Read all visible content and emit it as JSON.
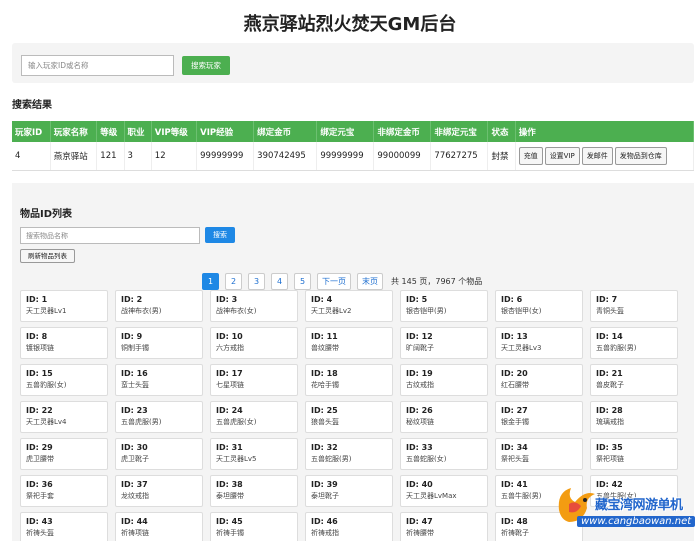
{
  "title": "燕京驿站烈火焚天GM后台",
  "player_search": {
    "placeholder": "输入玩家ID或名称",
    "button": "搜索玩家"
  },
  "results": {
    "heading": "搜索结果",
    "columns": [
      "玩家ID",
      "玩家名称",
      "等级",
      "职业",
      "VIP等级",
      "VIP经验",
      "绑定金币",
      "绑定元宝",
      "非绑定金币",
      "非绑定元宝",
      "状态",
      "操作"
    ],
    "rows": [
      {
        "cells": [
          "4",
          "燕京驿站",
          "121",
          "3",
          "12",
          "99999999",
          "390742495",
          "99999999",
          "99000099",
          "77627275",
          "封禁"
        ],
        "actions": [
          "充值",
          "设置VIP",
          "发邮件",
          "发物品到仓库"
        ]
      }
    ]
  },
  "items": {
    "heading": "物品ID列表",
    "search_placeholder": "搜索物品名称",
    "search_button": "搜索",
    "refresh_button": "刷新物品列表",
    "pages": [
      "1",
      "2",
      "3",
      "4",
      "5"
    ],
    "active_page": "1",
    "next": "下一页",
    "last": "末页",
    "summary": "共 145 页，7967 个物品",
    "list": [
      {
        "id": "ID: 1",
        "name": "天工灵器Lv1"
      },
      {
        "id": "ID: 2",
        "name": "战神布衣(男)"
      },
      {
        "id": "ID: 3",
        "name": "战神布衣(女)"
      },
      {
        "id": "ID: 4",
        "name": "天工灵器Lv2"
      },
      {
        "id": "ID: 5",
        "name": "银杏铠甲(男)"
      },
      {
        "id": "ID: 6",
        "name": "银杏铠甲(女)"
      },
      {
        "id": "ID: 7",
        "name": "青铜头盔"
      },
      {
        "id": "ID: 8",
        "name": "镀银项链"
      },
      {
        "id": "ID: 9",
        "name": "铜制手镯"
      },
      {
        "id": "ID: 10",
        "name": "六方戒指"
      },
      {
        "id": "ID: 11",
        "name": "兽纹腰带"
      },
      {
        "id": "ID: 12",
        "name": "旷阔靴子"
      },
      {
        "id": "ID: 13",
        "name": "天工灵器Lv3"
      },
      {
        "id": "ID: 14",
        "name": "五兽豹服(男)"
      },
      {
        "id": "ID: 15",
        "name": "五兽豹服(女)"
      },
      {
        "id": "ID: 16",
        "name": "蛮士头盔"
      },
      {
        "id": "ID: 17",
        "name": "七星项链"
      },
      {
        "id": "ID: 18",
        "name": "花哈手镯"
      },
      {
        "id": "ID: 19",
        "name": "古纹戒指"
      },
      {
        "id": "ID: 20",
        "name": "红石腰带"
      },
      {
        "id": "ID: 21",
        "name": "兽皮靴子"
      },
      {
        "id": "ID: 22",
        "name": "天工灵器Lv4"
      },
      {
        "id": "ID: 23",
        "name": "五兽虎服(男)"
      },
      {
        "id": "ID: 24",
        "name": "五兽虎服(女)"
      },
      {
        "id": "ID: 25",
        "name": "狼兽头盔"
      },
      {
        "id": "ID: 26",
        "name": "秘纹项链"
      },
      {
        "id": "ID: 27",
        "name": "银金手镯"
      },
      {
        "id": "ID: 28",
        "name": "琉璃戒指"
      },
      {
        "id": "ID: 29",
        "name": "虎卫腰带"
      },
      {
        "id": "ID: 30",
        "name": "虎卫靴子"
      },
      {
        "id": "ID: 31",
        "name": "天工灵器Lv5"
      },
      {
        "id": "ID: 32",
        "name": "五兽蛇服(男)"
      },
      {
        "id": "ID: 33",
        "name": "五兽蛇服(女)"
      },
      {
        "id": "ID: 34",
        "name": "祭祀头盔"
      },
      {
        "id": "ID: 35",
        "name": "祭祀项链"
      },
      {
        "id": "ID: 36",
        "name": "祭祀手套"
      },
      {
        "id": "ID: 37",
        "name": "龙纹戒指"
      },
      {
        "id": "ID: 38",
        "name": "泰坦腰带"
      },
      {
        "id": "ID: 39",
        "name": "泰坦靴子"
      },
      {
        "id": "ID: 40",
        "name": "天工灵器LvMax"
      },
      {
        "id": "ID: 41",
        "name": "五兽牛服(男)"
      },
      {
        "id": "ID: 42",
        "name": "五兽牛服(女)"
      },
      {
        "id": "ID: 43",
        "name": "祈祷头盔"
      },
      {
        "id": "ID: 44",
        "name": "祈祷项链"
      },
      {
        "id": "ID: 45",
        "name": "祈祷手镯"
      },
      {
        "id": "ID: 46",
        "name": "祈祷戒指"
      },
      {
        "id": "ID: 47",
        "name": "祈祷腰带"
      },
      {
        "id": "ID: 48",
        "name": "祈祷靴子"
      }
    ]
  },
  "watermark": {
    "cn": "藏宝湾网游单机",
    "en": "www.cangbaowan.net"
  },
  "colors": {
    "accent_green": "#4caf50",
    "accent_blue": "#1e88e5"
  }
}
